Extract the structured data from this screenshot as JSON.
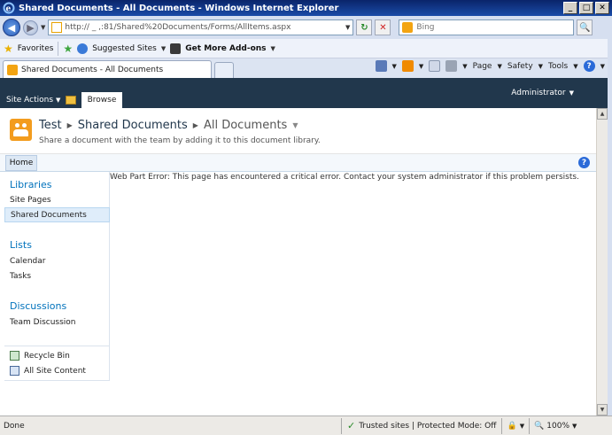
{
  "window": {
    "title": "Shared Documents - All Documents - Windows Internet Explorer",
    "min_glyph": "_",
    "max_glyph": "□",
    "close_glyph": "✕"
  },
  "addressbar": {
    "url": "http://  _  ,:81/Shared%20Documents/Forms/AllItems.aspx",
    "search_placeholder": "Bing",
    "search_glyph": "🔍"
  },
  "favorites": {
    "favorites_label": "Favorites",
    "suggested_label": "Suggested Sites",
    "addons_label": "Get More Add-ons"
  },
  "tab": {
    "label": "Shared Documents - All Documents"
  },
  "commands": {
    "page_label": "Page",
    "safety_label": "Safety",
    "tools_label": "Tools",
    "help_glyph": "?"
  },
  "ribbon": {
    "site_actions_label": "Site Actions",
    "browse_label": "Browse",
    "user_label": "Administrator"
  },
  "titlearea": {
    "site_name": "Test",
    "library_name": "Shared Documents",
    "view_name": "All Documents",
    "description": "Share a document with the team by adding it to this document library."
  },
  "topnav": {
    "home_label": "Home",
    "help_glyph": "?"
  },
  "quicklaunch": {
    "libraries": {
      "heading": "Libraries",
      "items": [
        "Site Pages",
        "Shared Documents"
      ]
    },
    "lists": {
      "heading": "Lists",
      "items": [
        "Calendar",
        "Tasks"
      ]
    },
    "discussions": {
      "heading": "Discussions",
      "items": [
        "Team Discussion"
      ]
    },
    "recycle_bin_label": "Recycle Bin",
    "all_site_content_label": "All Site Content"
  },
  "main": {
    "error_message": "Web Part Error: This page has encountered a critical error. Contact your system administrator if this problem persists."
  },
  "statusbar": {
    "done_label": "Done",
    "zone_label": "Trusted sites | Protected Mode: Off",
    "zoom_label": "100%"
  }
}
